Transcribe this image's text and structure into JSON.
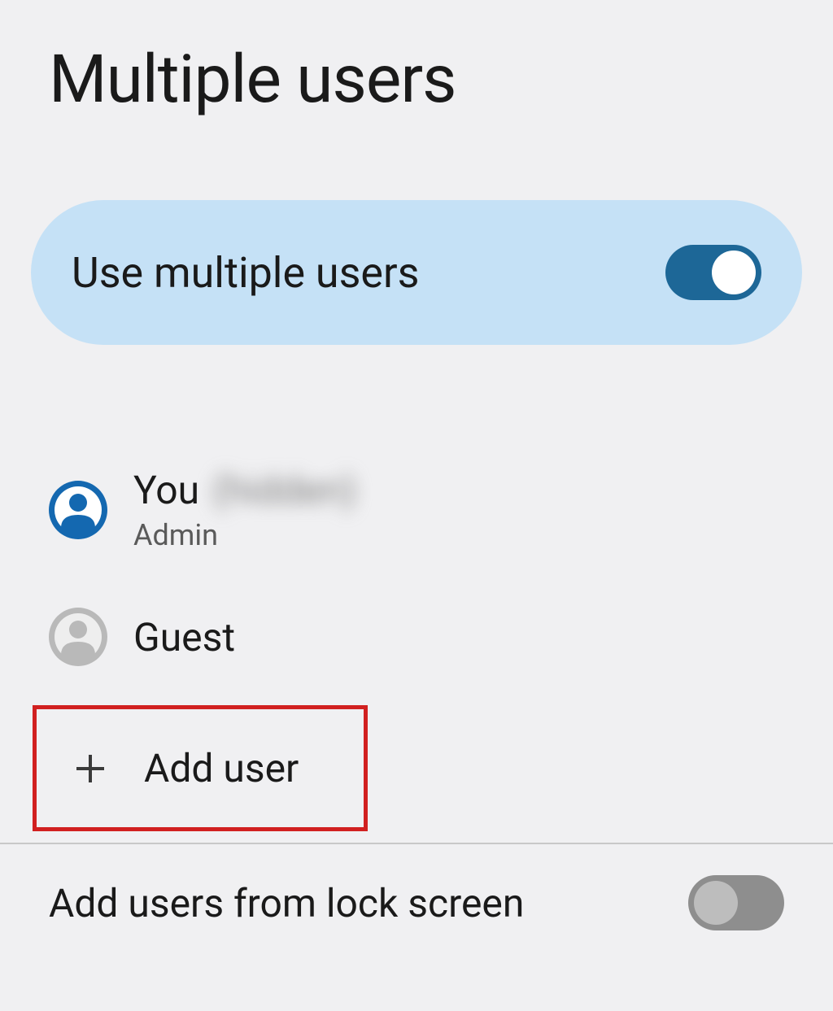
{
  "header": {
    "title": "Multiple users"
  },
  "toggleCard": {
    "label": "Use multiple users",
    "enabled": true
  },
  "users": [
    {
      "name": "You",
      "extra": "(hidden)",
      "subtitle": "Admin",
      "avatarColor": "#1468b0"
    },
    {
      "name": "Guest",
      "subtitle": "",
      "avatarColor": "#b9b9b9"
    }
  ],
  "addUser": {
    "label": "Add user"
  },
  "lockScreen": {
    "label": "Add users from lock screen",
    "enabled": false
  }
}
